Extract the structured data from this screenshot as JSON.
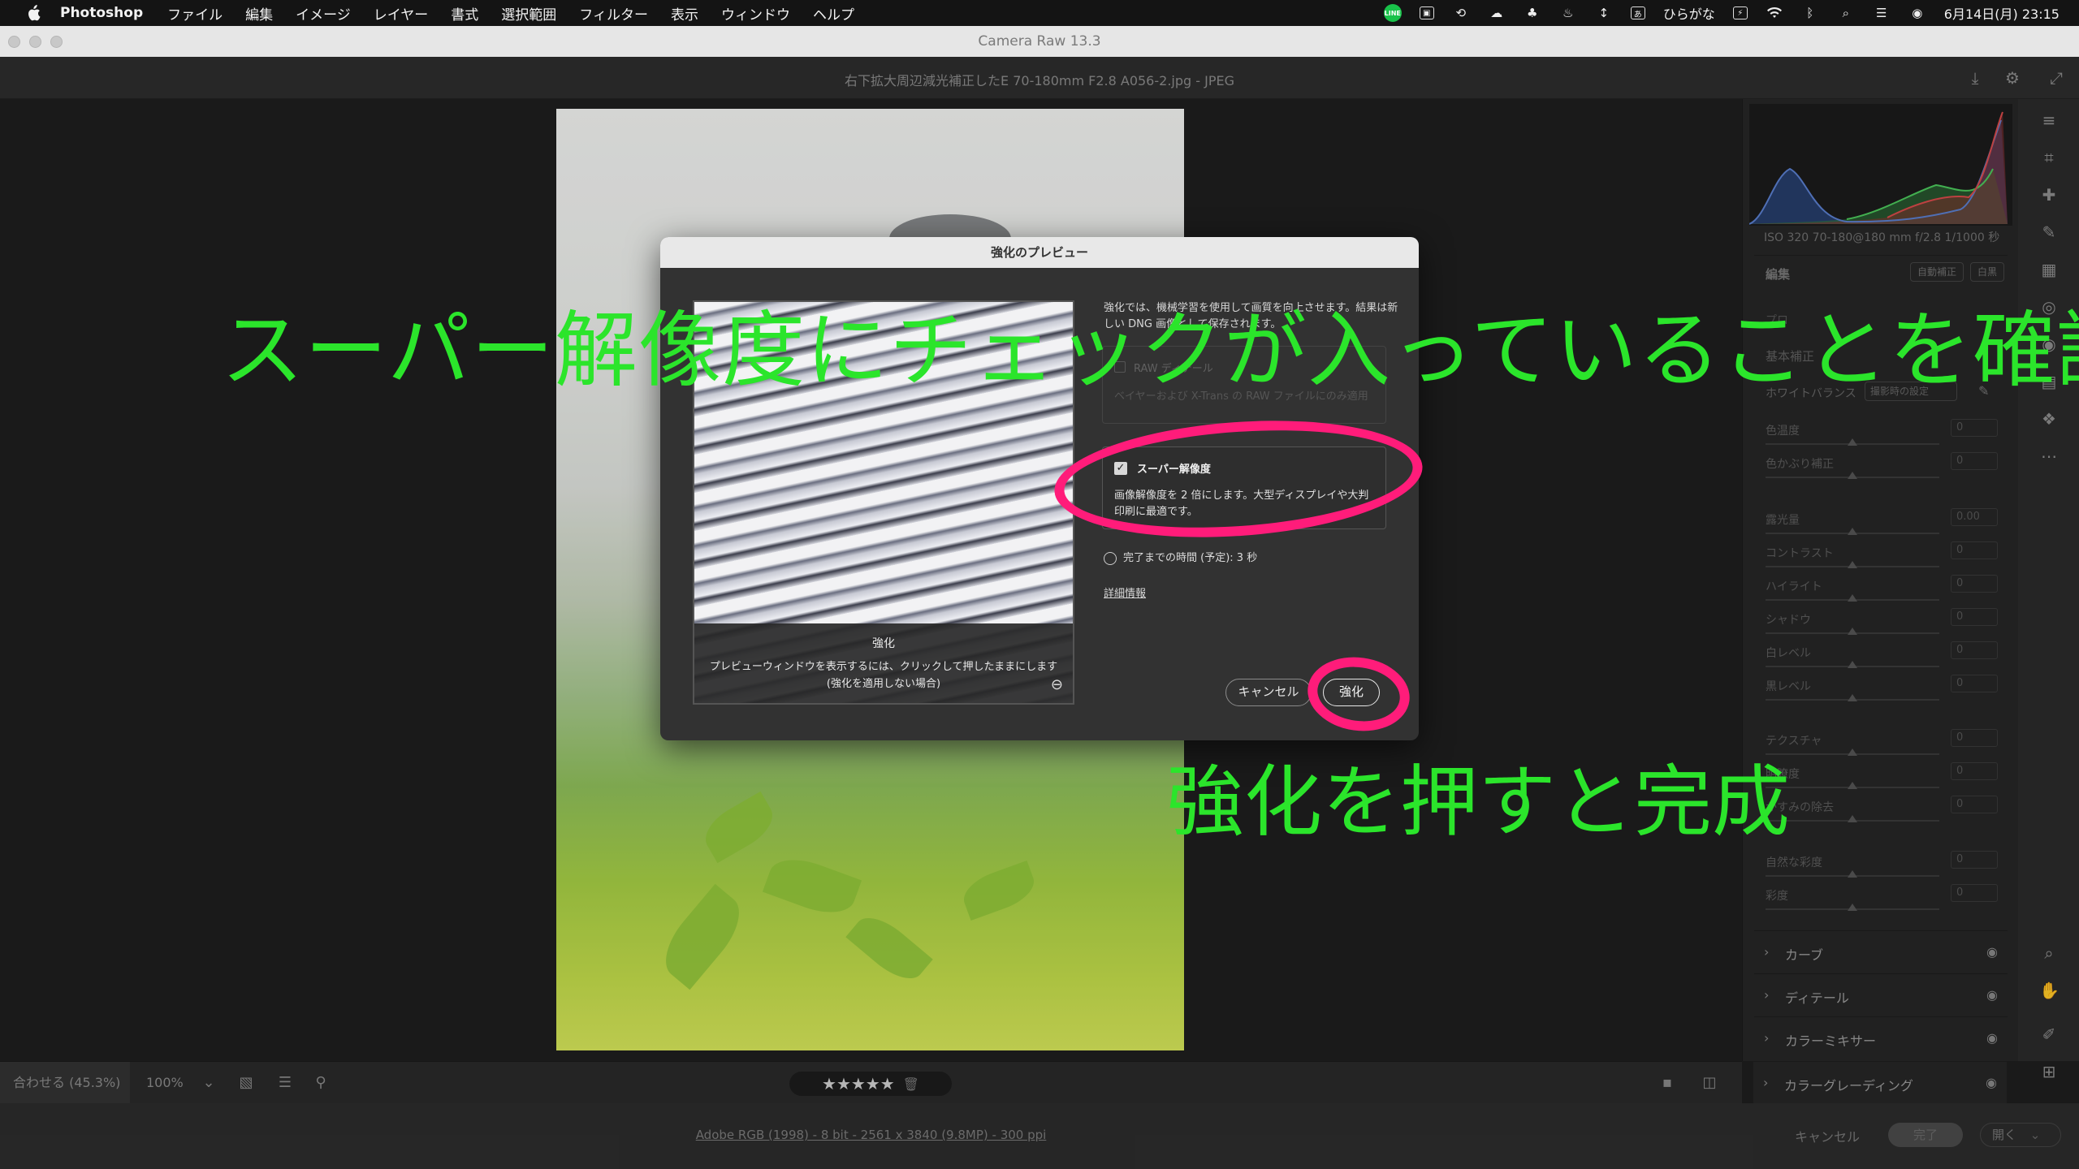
{
  "menubar": {
    "app": "Photoshop",
    "items": [
      "ファイル",
      "編集",
      "イメージ",
      "レイヤー",
      "書式",
      "選択範囲",
      "フィルター",
      "表示",
      "ウィンドウ",
      "ヘルプ"
    ],
    "input_method": "ひらがな",
    "datetime": "6月14日(月) 23:15"
  },
  "window": {
    "title": "Camera Raw 13.3"
  },
  "file": {
    "name": "右下拡大周辺減光補正したE 70-180mm F2.8 A056-2.jpg  -  JPEG"
  },
  "panel": {
    "meta": "ISO 320   70-180@180 mm   f/2.8   1/1000 秒",
    "edit_title": "編集",
    "auto_label": "自動補正",
    "bw_label": "白黒",
    "profile": "プロ",
    "section_basic": "基本補正",
    "wb_label": "ホワイトバランス",
    "wb_value": "撮影時の設定",
    "sliders": [
      {
        "label": "色温度",
        "value": "0"
      },
      {
        "label": "色かぶり補正",
        "value": "0"
      },
      {
        "label": "露光量",
        "value": "0.00"
      },
      {
        "label": "コントラスト",
        "value": "0"
      },
      {
        "label": "ハイライト",
        "value": "0"
      },
      {
        "label": "シャドウ",
        "value": "0"
      },
      {
        "label": "白レベル",
        "value": "0"
      },
      {
        "label": "黒レベル",
        "value": "0"
      },
      {
        "label": "テクスチャ",
        "value": "0"
      },
      {
        "label": "明瞭度",
        "value": "0"
      },
      {
        "label": "かすみの除去",
        "value": "0"
      },
      {
        "label": "自然な彩度",
        "value": "0"
      },
      {
        "label": "彩度",
        "value": "0"
      }
    ],
    "accordions": [
      "カーブ",
      "ディテール",
      "カラーミキサー",
      "カラーグレーディング"
    ]
  },
  "bottom": {
    "zoom_fit": "合わせる (45.3%)",
    "zoom_100": "100%",
    "stars": "★★★★★"
  },
  "footer": {
    "info": "Adobe RGB (1998) - 8 bit - 2561 x 3840 (9.8MP) - 300 ppi",
    "cancel": "キャンセル",
    "done": "完了",
    "open": "開く"
  },
  "dialog": {
    "title": "強化のプレビュー",
    "preview_title": "強化",
    "preview_line1": "プレビューウィンドウを表示するには、クリックして押したままにします",
    "preview_line2": "(強化を適用しない場合)",
    "description": "強化では、機械学習を使用して画質を向上させます。結果は新しい DNG 画像として保存されます。",
    "raw_detail_label": "RAW ディテール",
    "raw_detail_sub": "ベイヤーおよび X-Trans の RAW ファイルにのみ適用",
    "super_res_label": "スーパー解像度",
    "super_res_sub": "画像解像度を 2 倍にします。大型ディスプレイや大判印刷に最適です。",
    "time_label": "完了までの時間 (予定): 3 秒",
    "detail_link": "詳細情報",
    "cancel": "キャンセル",
    "enhance": "強化"
  },
  "annotations": {
    "main": "スーパー解像度にチェックが入っていることを確認",
    "sub": "強化を押すと完成",
    "color": "#2be52b",
    "ring_color": "#ff1c7a"
  }
}
